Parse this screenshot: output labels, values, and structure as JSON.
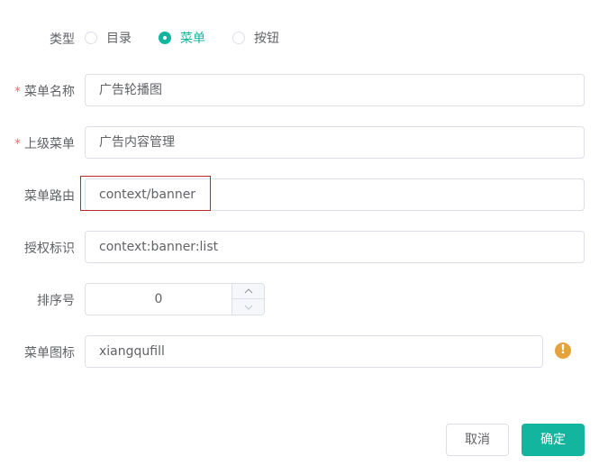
{
  "form": {
    "type": {
      "label": "类型",
      "options": [
        {
          "label": "目录",
          "checked": false
        },
        {
          "label": "菜单",
          "checked": true
        },
        {
          "label": "按钮",
          "checked": false
        }
      ]
    },
    "menu_name": {
      "label": "菜单名称",
      "required": "*",
      "value": "广告轮播图"
    },
    "parent_menu": {
      "label": "上级菜单",
      "required": "*",
      "value": "广告内容管理"
    },
    "route": {
      "label": "菜单路由",
      "value": "context/banner"
    },
    "permission": {
      "label": "授权标识",
      "value": "context:banner:list"
    },
    "order": {
      "label": "排序号",
      "value": "0"
    },
    "icon": {
      "label": "菜单图标",
      "value": "xiangqufill",
      "warning_glyph": "!"
    }
  },
  "actions": {
    "cancel_label": "取消",
    "confirm_label": "确定"
  },
  "colors": {
    "accent": "#13b59f",
    "warning": "#e6a23c",
    "required": "#f56c6c",
    "highlight": "#c0282f"
  }
}
